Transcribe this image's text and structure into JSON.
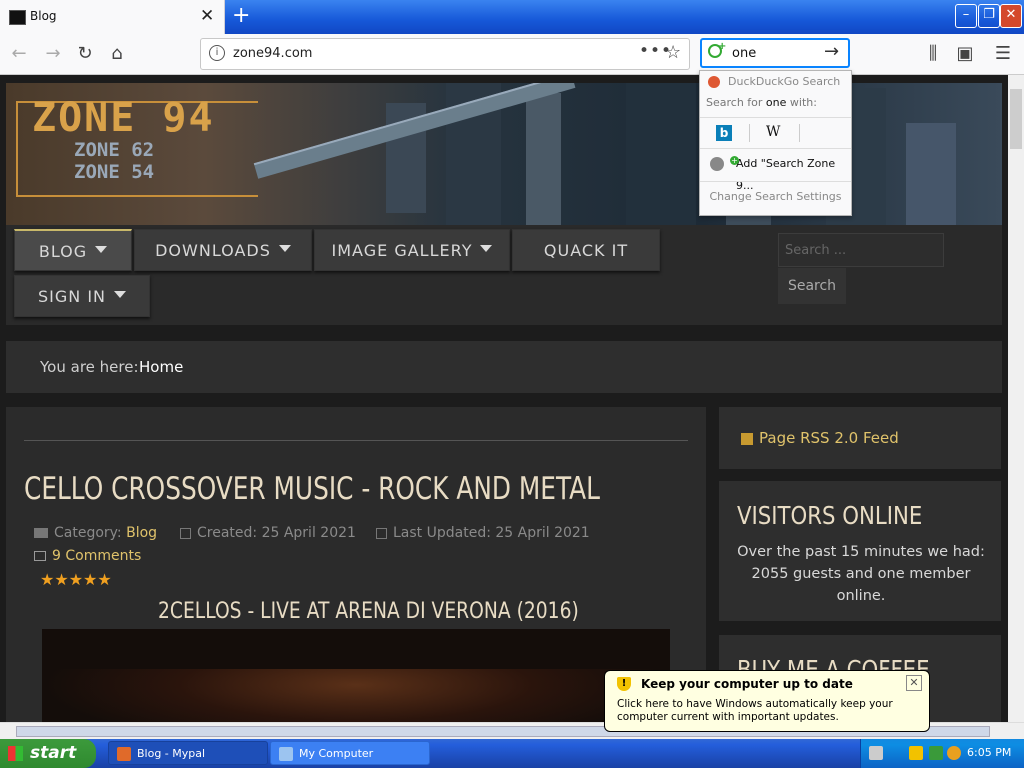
{
  "browser": {
    "tab_title": "Blog",
    "url": "zone94.com",
    "search_value": "one",
    "dropdown": {
      "engine_title": "DuckDuckGo Search",
      "search_for_prefix": "Search for ",
      "search_for_term": "one",
      "search_for_suffix": " with:",
      "wiki_label": "W",
      "bing_label": "b",
      "add_engine": "Add \"Search Zone 9...",
      "change_settings": "Change Search Settings"
    }
  },
  "site": {
    "logo_main": "ZONE 94",
    "logo_sub1": "ZONE 62",
    "logo_sub2": "ZONE 54",
    "menu": {
      "blog": "BLOG",
      "downloads": "DOWNLOADS",
      "image_gallery": "IMAGE GALLERY",
      "quack_it": "QUACK IT",
      "sign_in": "SIGN IN"
    },
    "search_placeholder": "Search ...",
    "search_button": "Search",
    "breadcrumb_label": "You are here:",
    "breadcrumb_home": "Home",
    "article": {
      "title": "CELLO CROSSOVER MUSIC - ROCK AND METAL",
      "category_label": "Category:",
      "category": "Blog",
      "created": "Created: 25 April 2021",
      "updated": "Last Updated: 25 April 2021",
      "comments": "9 Comments",
      "rating_stars": "★★★★★",
      "subheading": "2CELLOS - LIVE AT ARENA DI VERONA (2016)"
    },
    "sidebar": {
      "rss": "Page RSS 2.0 Feed",
      "visitors_title": "VISITORS ONLINE",
      "visitors_text": "Over the past 15 minutes we had: 2055 guests and one member online.",
      "coffee_title": "BUY ME A COFFEE"
    }
  },
  "balloon": {
    "title": "Keep your computer up to date",
    "body": "Click here to have Windows automatically keep your computer current with important updates."
  },
  "taskbar": {
    "start": "start",
    "tasks": [
      "Blog - Mypal",
      "My Computer"
    ],
    "clock": "6:05 PM"
  },
  "colors": {
    "accent_gold": "#e0c36b",
    "title_cream": "#e8dcc4",
    "firefox_blue": "#0a84ff",
    "xp_taskbar": "#245edb"
  }
}
